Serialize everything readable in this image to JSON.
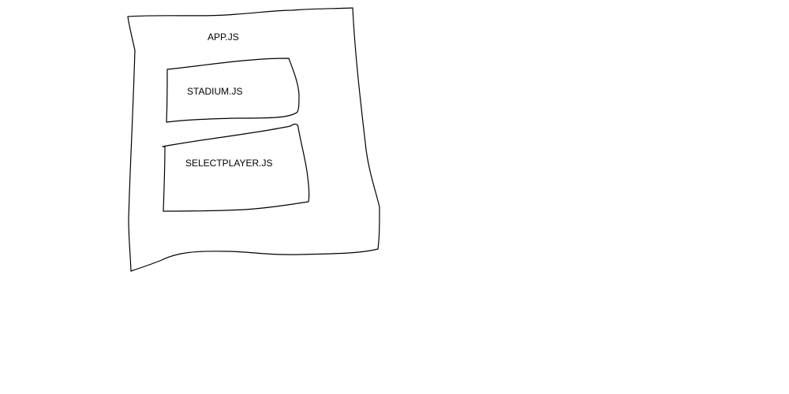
{
  "diagram": {
    "stroke_color": "#000000",
    "background_color": "#ffffff",
    "boxes": [
      {
        "id": "app",
        "label": "APP.JS"
      },
      {
        "id": "stadium",
        "label": "STADIUM.JS"
      },
      {
        "id": "selectplayer",
        "label": "SELECTPLAYER.JS"
      }
    ]
  }
}
